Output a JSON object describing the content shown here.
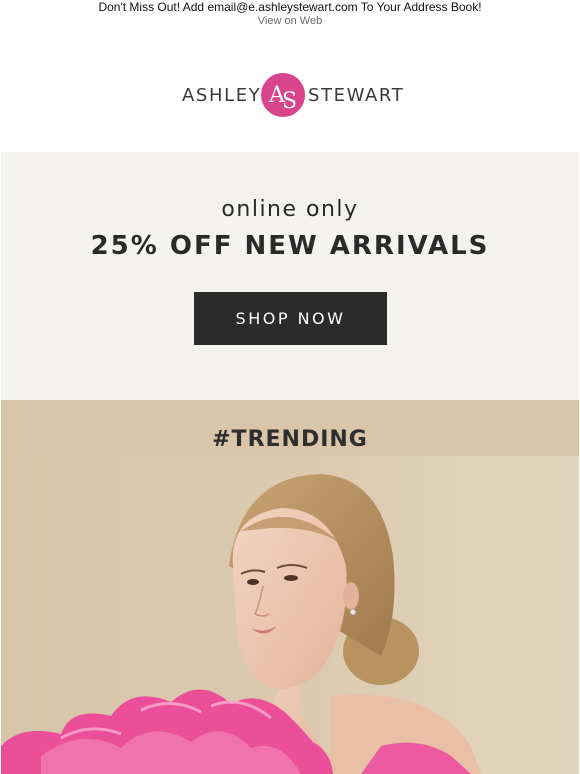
{
  "preheader": {
    "message": "Don't Miss Out! Add email@e.ashleystewart.com To Your Address Book!",
    "view_link": "View on Web"
  },
  "logo": {
    "left_word": "ASHLEY",
    "right_word": "STEWART",
    "mark_letters": "AS",
    "mark_color": "#d9458c"
  },
  "promo": {
    "subheadline": "online only",
    "headline": "25% OFF NEW ARRIVALS",
    "cta_label": "SHOP NOW"
  },
  "trending": {
    "title": "#TRENDING"
  },
  "colors": {
    "promo_background": "#f4f3f0",
    "trending_background": "#d9c6aa",
    "button_background": "#2b2b2b",
    "ruffle_pink": "#ec4f9a"
  }
}
